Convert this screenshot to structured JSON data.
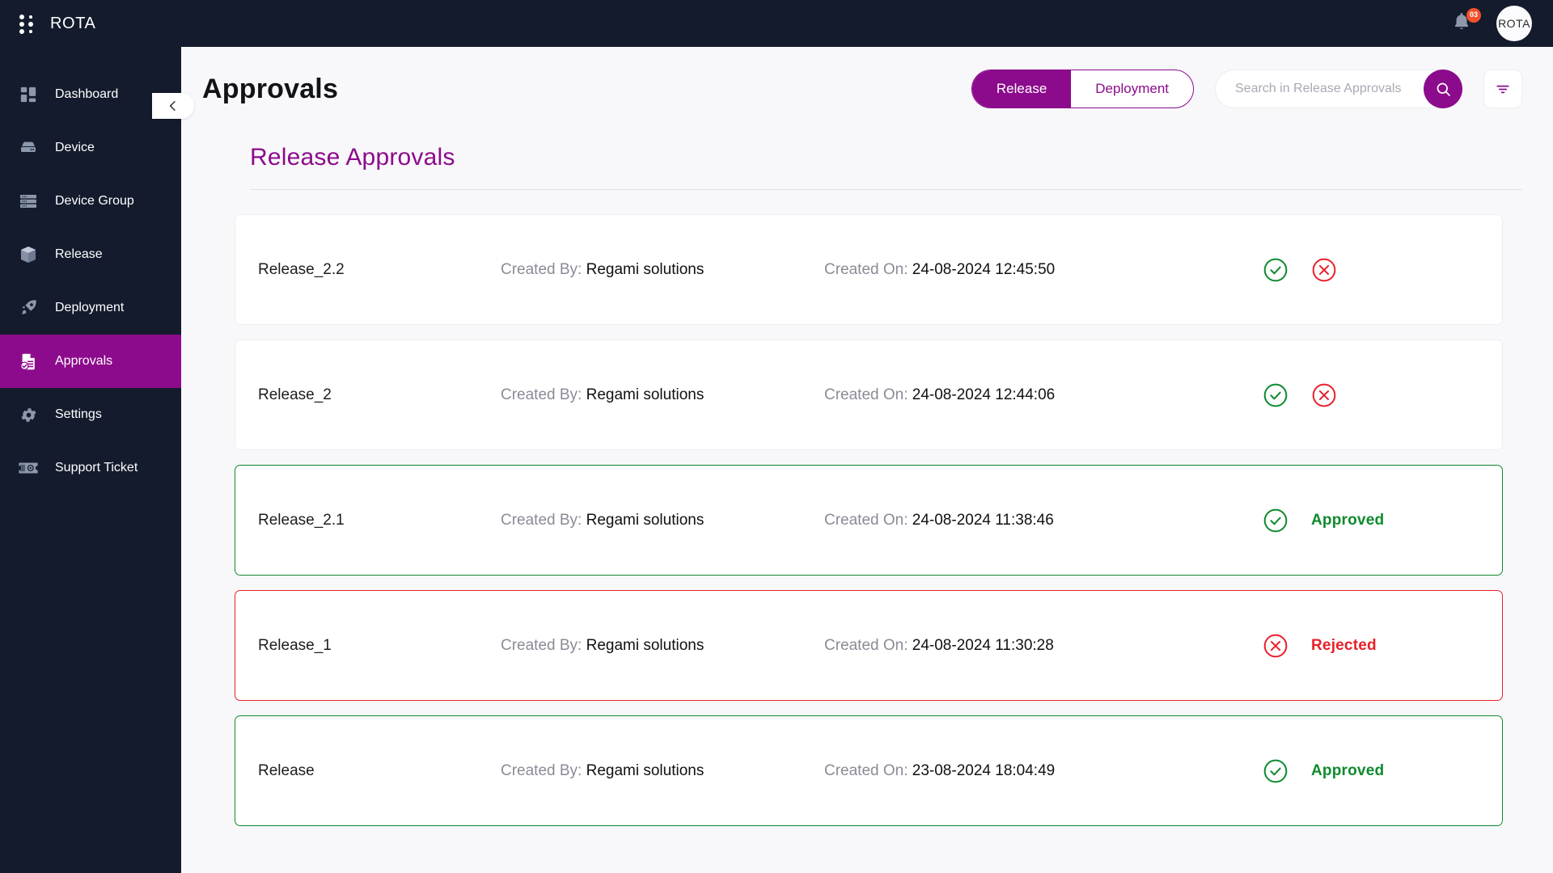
{
  "topbar": {
    "brand_name": "ROTA",
    "logo_icon": "dots-grid-icon",
    "notification_icon": "bell-icon",
    "notification_count": "03",
    "avatar_label": "ROTA"
  },
  "sidebar": {
    "collapse_icon": "chevron-left-icon",
    "items": [
      {
        "label": "Dashboard",
        "icon": "dashboard-icon",
        "active": false
      },
      {
        "label": "Device",
        "icon": "device-icon",
        "active": false
      },
      {
        "label": "Device Group",
        "icon": "device-group-icon",
        "active": false
      },
      {
        "label": "Release",
        "icon": "package-icon",
        "active": false
      },
      {
        "label": "Deployment",
        "icon": "rocket-icon",
        "active": false
      },
      {
        "label": "Approvals",
        "icon": "approvals-icon",
        "active": true
      },
      {
        "label": "Settings",
        "icon": "gear-icon",
        "active": false
      },
      {
        "label": "Support Ticket",
        "icon": "ticket-icon",
        "active": false
      }
    ]
  },
  "header": {
    "page_title": "Approvals",
    "tabs": [
      {
        "label": "Release",
        "selected": true
      },
      {
        "label": "Deployment",
        "selected": false
      }
    ],
    "search": {
      "placeholder": "Search in Release Approvals",
      "value": "",
      "button_icon": "search-icon"
    },
    "filter_icon": "filter-icon"
  },
  "section": {
    "title": "Release Approvals"
  },
  "labels": {
    "created_by": "Created By:",
    "created_on": "Created On:",
    "approve_icon": "check-circle-icon",
    "reject_icon": "x-circle-icon"
  },
  "rows": [
    {
      "name": "Release_2.2",
      "created_by_value": "Regami solutions",
      "created_on_value": "24-08-2024 12:45:50",
      "state": "pending",
      "status_text": ""
    },
    {
      "name": "Release_2",
      "created_by_value": "Regami solutions",
      "created_on_value": "24-08-2024 12:44:06",
      "state": "pending",
      "status_text": ""
    },
    {
      "name": "Release_2.1",
      "created_by_value": "Regami solutions",
      "created_on_value": "24-08-2024 11:38:46",
      "state": "approved",
      "status_text": "Approved"
    },
    {
      "name": "Release_1",
      "created_by_value": "Regami solutions",
      "created_on_value": "24-08-2024 11:30:28",
      "state": "rejected",
      "status_text": "Rejected"
    },
    {
      "name": "Release",
      "created_by_value": "Regami solutions",
      "created_on_value": "23-08-2024 18:04:49",
      "state": "approved",
      "status_text": "Approved"
    }
  ],
  "colors": {
    "brand_purple": "#8c0b8c",
    "sidebar_dark": "#141b2d",
    "approved_green": "#0f8a2e",
    "rejected_red": "#e8202a",
    "badge_orange": "#f0512b"
  }
}
